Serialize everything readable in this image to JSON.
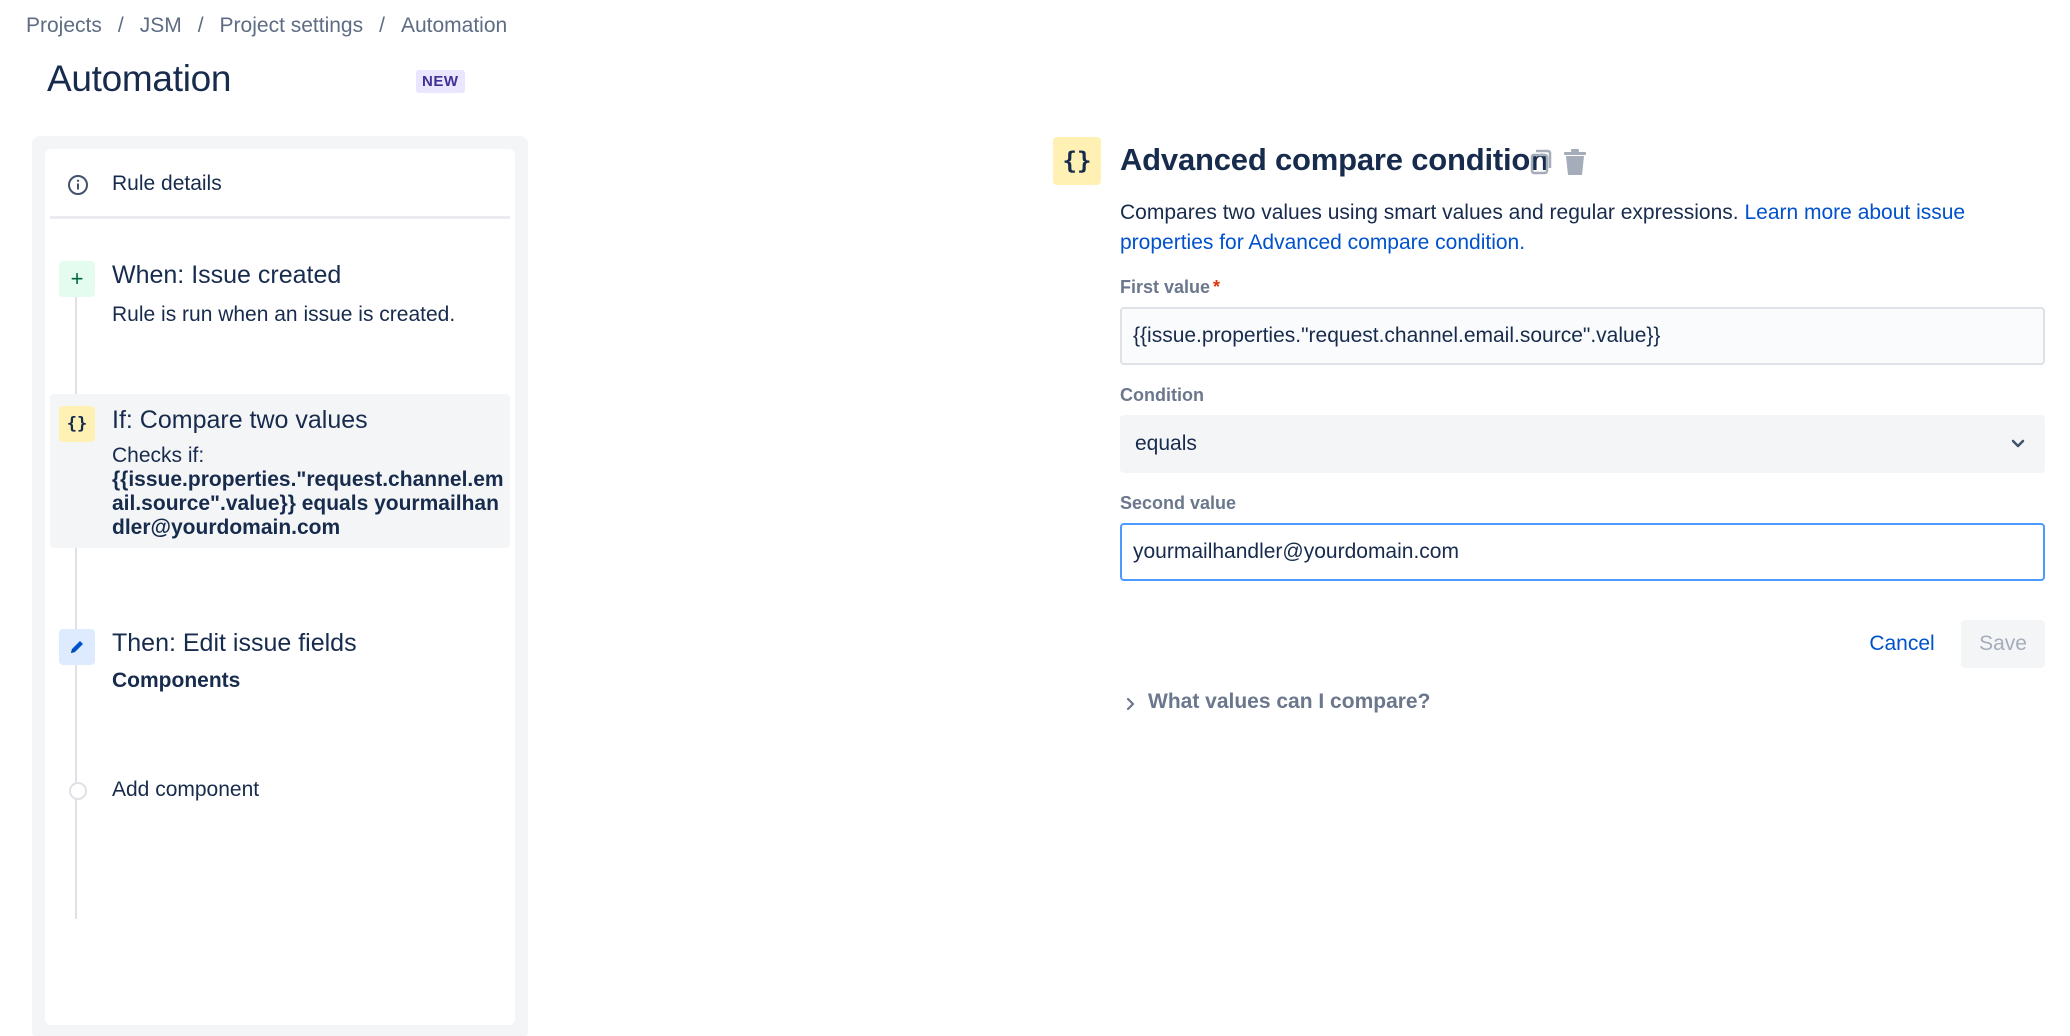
{
  "breadcrumb": {
    "items": [
      "Projects",
      "JSM",
      "Project settings",
      "Automation"
    ],
    "separator": "/"
  },
  "header": {
    "title": "Automation",
    "badge": "NEW"
  },
  "rule": {
    "details_label": "Rule details",
    "steps": [
      {
        "title": "When: Issue created",
        "description": "Rule is run when an issue is created.",
        "icon": "plus-icon"
      },
      {
        "title": "If: Compare two values",
        "description_prefix": "Checks if:",
        "description_value": "{{issue.properties.\"request.channel.email.source\".value}} equals yourmailhandler@yourdomain.com",
        "icon": "braces-icon"
      },
      {
        "title": "Then: Edit issue fields",
        "description": "Components",
        "icon": "pencil-icon"
      }
    ],
    "add_component_label": "Add component"
  },
  "condition": {
    "icon_glyph": "{}",
    "title": "Advanced compare condition",
    "description": "Compares two values using smart values and regular expressions. ",
    "learn_more_link": "Learn more about issue properties for Advanced compare condition.",
    "first_value_label": "First value",
    "required_marker": "*",
    "first_value": "{{issue.properties.\"request.channel.email.source\".value}}",
    "condition_label": "Condition",
    "condition_value": "equals",
    "second_value_label": "Second value",
    "second_value": "yourmailhandler@yourdomain.com",
    "cancel_label": "Cancel",
    "save_label": "Save",
    "expander_label": "What values can I compare?"
  },
  "icons": {
    "plus": "+",
    "braces": "{}"
  },
  "colors": {
    "link": "#0052cc",
    "text": "#172b4d",
    "subtle": "#6b778c",
    "trigger_bg": "#e3fcef",
    "condition_bg": "#fff0b3",
    "action_bg": "#deebff",
    "focus_border": "#4c9aff",
    "required": "#de350b"
  }
}
